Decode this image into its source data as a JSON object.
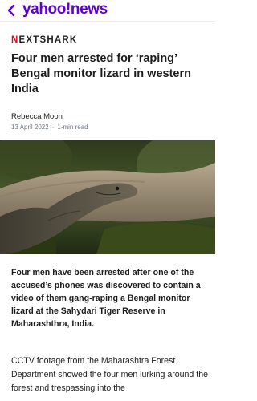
{
  "header": {
    "back_icon": "chevron-left-icon",
    "logo_text": "yahoo",
    "logo_bang": "!",
    "logo_suffix": "news",
    "brand_color": "#6001d2"
  },
  "article": {
    "publisher_prefix": "N",
    "publisher_rest": "EXTSHARK",
    "publisher_accent": "#e00a1b",
    "headline": "Four men arrested for ‘raping’ Bengal monitor lizard in western India",
    "author": "Rebecca Moon",
    "date": "13 April 2022",
    "separator": "·",
    "read_time": "1-min read",
    "image_subject": "monitor-lizard-photo",
    "lede": "Four men have been arrested after one of the accused’s phones was discovered to contain a video of them gang-raping a Bengal monitor lizard at the Sahydari Tiger Reserve in Maharashthra, India.",
    "paragraph_1": "CCTV footage from the Maharashtra Forest Department showed the four men lurking around the forest and trespassing into the"
  }
}
